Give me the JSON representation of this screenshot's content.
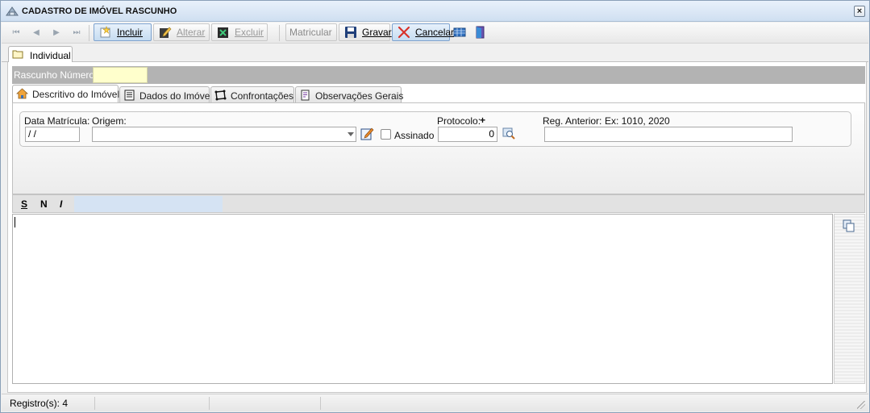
{
  "window": {
    "title": "CADASTRO DE IMÓVEL RASCUNHO",
    "close_glyph": "×"
  },
  "toolbar": {
    "nav": [
      "⏮",
      "◀",
      "▶",
      "⏭"
    ],
    "incluir": "Incluir",
    "alterar": "Alterar",
    "excluir": "Excluir",
    "matricular": "Matricular",
    "gravar": "Gravar",
    "cancelar": "Cancelar"
  },
  "outer_tab": {
    "label": "Individual"
  },
  "rascunho": {
    "label": "Rascunho Número:",
    "value": ""
  },
  "inner_tabs": [
    {
      "label": "Descritivo do Imóvel",
      "icon": "house-icon"
    },
    {
      "label": "Dados do Imóvel",
      "icon": "document-icon"
    },
    {
      "label": "Confrontações",
      "icon": "polygon-icon"
    },
    {
      "label": "Observações Gerais",
      "icon": "notes-icon"
    }
  ],
  "form": {
    "data_matricula_label": "Data Matrícula:",
    "data_matricula_value": " /  /",
    "origem_label": "Origem:",
    "origem_value": "",
    "assinado_label": "Assinado",
    "protocolo_label": "Protocolo:",
    "protocolo_plus": "+",
    "protocolo_value": "0",
    "reg_anterior_label": "Reg. Anterior:",
    "reg_anterior_hint": "Ex: 1010, 2020",
    "reg_anterior_value": ""
  },
  "format_bar": {
    "s": "S",
    "n": "N",
    "i": "I"
  },
  "editor": {
    "text": ""
  },
  "status": {
    "registros": "Registro(s): 4"
  },
  "colors": {
    "title_gradient_top": "#e9f1fb",
    "rascunho_input": "#ffffcc",
    "status_gray": "#b3b3b3"
  }
}
